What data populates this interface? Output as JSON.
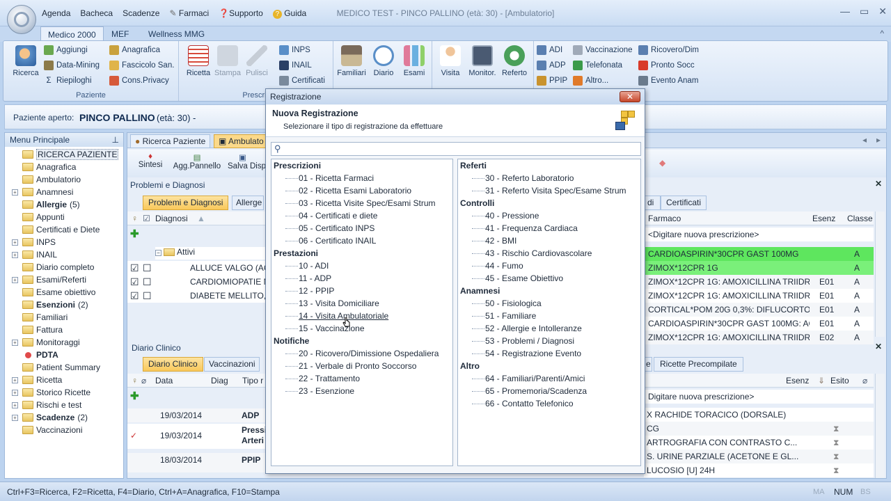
{
  "app": {
    "window_title": "MEDICO TEST - PINCO PALLINO (età: 30)   - [Ambulatorio]",
    "quick_access": [
      "Agenda",
      "Bacheca",
      "Scadenze",
      "Farmaci",
      "Supporto",
      "Guida"
    ],
    "ribbon_tabs": [
      "Medico 2000",
      "MEF",
      "Wellness MMG"
    ]
  },
  "ribbon": {
    "paziente": {
      "label": "Paziente",
      "ricerca": "Ricerca",
      "aggiungi": "Aggiungi",
      "data_mining": "Data-Mining",
      "riepiloghi": "Riepiloghi",
      "anagrafica": "Anagrafica",
      "fascicolo": "Fascicolo San.",
      "cons_privacy": "Cons.Privacy"
    },
    "prescrizioni": {
      "label": "Prescrizi",
      "ricetta": "Ricetta",
      "stampa": "Stampa",
      "pulisci": "Pulisci",
      "inps": "INPS",
      "inail": "INAIL",
      "certificati": "Certificati"
    },
    "visita": {
      "familiari": "Familiari",
      "diario": "Diario",
      "esami": "Esami",
      "visita": "Visita",
      "monitor": "Monitor.",
      "referto": "Referto",
      "adi": "ADI",
      "adp": "ADP",
      "ppip": "PPIP",
      "vaccinazione": "Vaccinazione",
      "telefonata": "Telefonata",
      "altro": "Altro...",
      "ricovero": "Ricovero/Dim",
      "pronto_socc": "Pronto Socc",
      "evento_anam": "Evento Anam"
    }
  },
  "patient_bar": {
    "label": "Paziente aperto:",
    "name": "PINCO PALLINO",
    "age": "(età: 30) -"
  },
  "menu": {
    "title": "Menu Principale",
    "items": [
      {
        "label": "RICERCA PAZIENTE",
        "bold": false,
        "expand": false
      },
      {
        "label": "Anagrafica",
        "bold": false,
        "expand": false
      },
      {
        "label": "Ambulatorio",
        "bold": false,
        "expand": false
      },
      {
        "label": "Anamnesi",
        "bold": false,
        "expand": true
      },
      {
        "label": "Allergie",
        "bold": true,
        "expand": false,
        "count": "(5)"
      },
      {
        "label": "Appunti",
        "bold": false,
        "expand": false
      },
      {
        "label": "Certificati e Diete",
        "bold": false,
        "expand": false
      },
      {
        "label": "INPS",
        "bold": false,
        "expand": true
      },
      {
        "label": "INAIL",
        "bold": false,
        "expand": true
      },
      {
        "label": "Diario completo",
        "bold": false,
        "expand": false
      },
      {
        "label": "Esami/Referti",
        "bold": false,
        "expand": true
      },
      {
        "label": "Esame obiettivo",
        "bold": false,
        "expand": false
      },
      {
        "label": "Esenzioni",
        "bold": true,
        "expand": false,
        "count": "(2)"
      },
      {
        "label": "Familiari",
        "bold": false,
        "expand": false
      },
      {
        "label": "Fattura",
        "bold": false,
        "expand": false
      },
      {
        "label": "Monitoraggi",
        "bold": false,
        "expand": true
      },
      {
        "label": "PDTA",
        "bold": true,
        "expand": false
      },
      {
        "label": "Patient Summary",
        "bold": false,
        "expand": false
      },
      {
        "label": "Ricetta",
        "bold": false,
        "expand": true
      },
      {
        "label": "Storico Ricette",
        "bold": false,
        "expand": true
      },
      {
        "label": "Rischi e test",
        "bold": false,
        "expand": true
      },
      {
        "label": "Scadenze",
        "bold": true,
        "expand": true,
        "count": "(2)"
      },
      {
        "label": "Vaccinazioni",
        "bold": false,
        "expand": false
      }
    ]
  },
  "content": {
    "doc_tabs": [
      "Ricerca Paziente",
      "Ambulato"
    ],
    "toolbar": [
      "Sintesi",
      "Agg.Pannello",
      "Salva Disp"
    ],
    "problemi_title": "Problemi e Diagnosi",
    "problemi_tabs": [
      "Problemi e Diagnosi",
      "Allerge"
    ],
    "diagnosi_header": "Diagnosi",
    "attivi": "Attivi",
    "diagnosi": [
      "ALLUCE VALGO (AC",
      "CARDIOMIOPATIE N",
      "DIABETE MELLITO,T"
    ],
    "diario_title": "Diario Clinico",
    "diario_tabs": [
      "Diario Clinico",
      "Vaccinazioni"
    ],
    "diario_headers": [
      "Data",
      "Diag",
      "Tipo r"
    ],
    "diario_rows": [
      {
        "date": "19/03/2014",
        "tipo": "ADP",
        "tipo2": ""
      },
      {
        "date": "19/03/2014",
        "tipo": "Pressi",
        "tipo2": "Arteri"
      },
      {
        "date": "18/03/2014",
        "tipo": "PPIP",
        "tipo2": ""
      }
    ],
    "right_tabs": [
      "di",
      "Certificati"
    ],
    "farmaco_headers": [
      "Farmaco",
      "Esenz",
      "Classe"
    ],
    "new_prescription": "<Digitare nuova prescrizione>",
    "farmaci": [
      {
        "name": "CARDIOASPIRIN*30CPR GAST 100MG",
        "esenz": "",
        "classe": "A",
        "hl": true
      },
      {
        "name": "ZIMOX*12CPR 1G",
        "esenz": "",
        "classe": "A",
        "hl": true
      },
      {
        "name": "ZIMOX*12CPR 1G: AMOXICILLINA TRIIDR...",
        "esenz": "E01",
        "classe": "A",
        "hl": false
      },
      {
        "name": "ZIMOX*12CPR 1G: AMOXICILLINA TRIIDR...",
        "esenz": "E01",
        "classe": "A",
        "hl": false
      },
      {
        "name": "CORTICAL*POM 20G 0,3%: DIFLUCORTOL...",
        "esenz": "E01",
        "classe": "A",
        "hl": false
      },
      {
        "name": "CARDIOASPIRIN*30CPR GAST 100MG: ACI...",
        "esenz": "E01",
        "classe": "A",
        "hl": false
      },
      {
        "name": "ZIMOX*12CPR 1G: AMOXICILLINA TRIIDR",
        "esenz": "E02",
        "classe": "A",
        "hl": false
      }
    ],
    "right2_tabs": [
      "e",
      "Ricette Precompilate"
    ],
    "esami_headers": [
      "Esenz",
      "Esito"
    ],
    "esami_new": "Digitare nuova prescrizione>",
    "esami": [
      "X RACHIDE TORACICO (DORSALE)",
      "CG",
      "ARTROGRAFIA CON CONTRASTO C...",
      "S. URINE PARZIALE (ACETONE E GL...",
      "LUCOSIO [U] 24H"
    ]
  },
  "status": {
    "shortcuts": "Ctrl+F3=Ricerca, F2=Ricetta, F4=Diario, Ctrl+A=Anagrafica, F10=Stampa",
    "ind1": "MA",
    "ind2": "NUM",
    "ind3": "BS"
  },
  "dialog": {
    "title": "Registrazione",
    "heading": "Nuova Registrazione",
    "subheading": "Selezionare il tipo di registrazione da effettuare",
    "search_placeholder": "",
    "left": [
      {
        "group": "Prescrizioni",
        "items": [
          "01 - Ricetta Farmaci",
          "02 - Ricetta Esami Laboratorio",
          "03 - Ricetta Visite Spec/Esami Strum",
          "04 - Certificati e diete",
          "05 - Certificato INPS",
          "06 - Certificato INAIL"
        ]
      },
      {
        "group": "Prestazioni",
        "items": [
          "10 - ADI",
          "11 - ADP",
          "12 - PPIP",
          "13 - Visita Domiciliare",
          "14 - Visita Ambulatoriale",
          "15 - Vaccinazione"
        ]
      },
      {
        "group": "Notifiche",
        "items": [
          "20 - Ricovero/Dimissione Ospedaliera",
          "21 - Verbale di Pronto Soccorso",
          "22 - Trattamento",
          "23 - Esenzione"
        ]
      }
    ],
    "right": [
      {
        "group": "Referti",
        "items": [
          "30 - Referto Laboratorio",
          "31 - Referto Visita Spec/Esame Strum"
        ]
      },
      {
        "group": "Controlli",
        "items": [
          "40 - Pressione",
          "41 - Frequenza Cardiaca",
          "42 - BMI",
          "43 - Rischio Cardiovascolare",
          "44 - Fumo",
          "45 - Esame Obiettivo"
        ]
      },
      {
        "group": "Anamnesi",
        "items": [
          "50 - Fisiologica",
          "51 - Familiare",
          "52 - Allergie e Intolleranze",
          "53 - Problemi / Diagnosi",
          "54 - Registrazione Evento"
        ]
      },
      {
        "group": "Altro",
        "items": [
          "64 - Familiari/Parenti/Amici",
          "65 - Promemoria/Scadenza",
          "66 - Contatto Telefonico"
        ]
      }
    ],
    "hovered": "14 - Visita Ambulatoriale"
  }
}
